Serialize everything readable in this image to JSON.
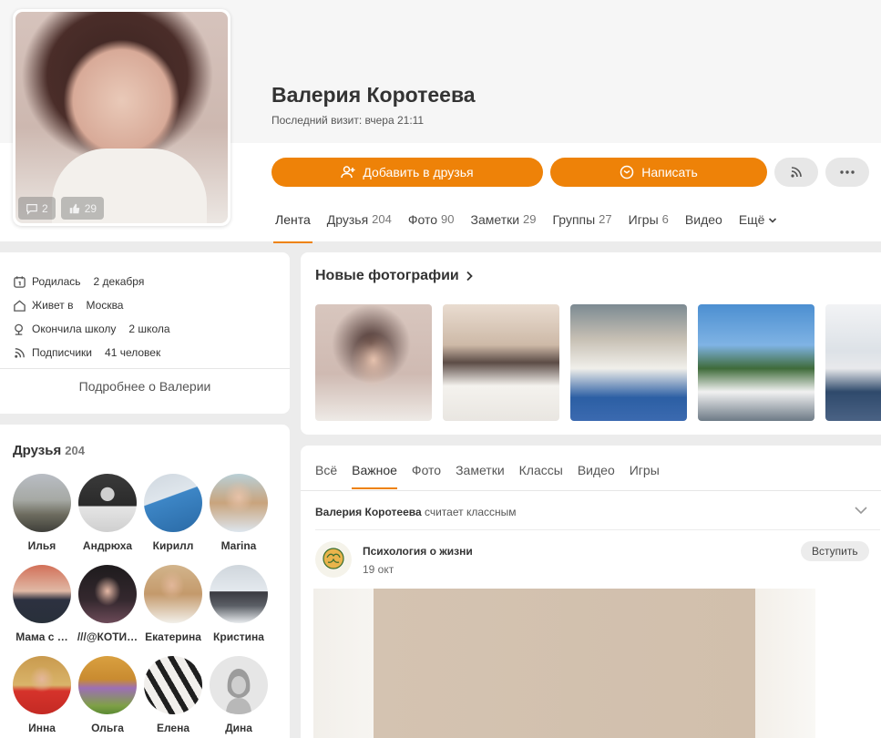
{
  "profile": {
    "name": "Валерия Коротеева",
    "last_visit": "Последний визит: вчера 21:11",
    "avatar_comments": "2",
    "avatar_likes": "29"
  },
  "actions": {
    "add_friend": "Добавить в друзья",
    "write": "Написать"
  },
  "nav": {
    "tabs": [
      {
        "label": "Лента",
        "count": ""
      },
      {
        "label": "Друзья",
        "count": "204"
      },
      {
        "label": "Фото",
        "count": "90"
      },
      {
        "label": "Заметки",
        "count": "29"
      },
      {
        "label": "Группы",
        "count": "27"
      },
      {
        "label": "Игры",
        "count": "6"
      },
      {
        "label": "Видео",
        "count": ""
      },
      {
        "label": "Ещё",
        "count": ""
      }
    ]
  },
  "info": {
    "born_label": "Родилась",
    "born_value": "2 декабря",
    "lives_label": "Живет в",
    "lives_value": "Москва",
    "school_label": "Окончила школу",
    "school_value": "2 школа",
    "subs_label": "Подписчики",
    "subs_value": "41 человек",
    "more": "Подробнее о Валерии"
  },
  "friends": {
    "title": "Друзья",
    "count": "204",
    "list": [
      "Илья",
      "Андрюха",
      "Кирилл",
      "Marina",
      "Мама с …",
      "///@КОТИ…",
      "Екатерина",
      "Кристина",
      "Инна",
      "Ольга",
      "Елена",
      "Дина"
    ]
  },
  "photos": {
    "title": "Новые фотографии"
  },
  "feed": {
    "tabs": [
      "Всё",
      "Важное",
      "Фото",
      "Заметки",
      "Классы",
      "Видео",
      "Игры"
    ],
    "liker_name": "Валерия Коротеева",
    "liker_action": " считает классным",
    "group_name": "Психология о жизни",
    "post_date": "19 окт",
    "join": "Вступить"
  },
  "colors": {
    "accent": "#ee8208",
    "background": "#ececec"
  }
}
